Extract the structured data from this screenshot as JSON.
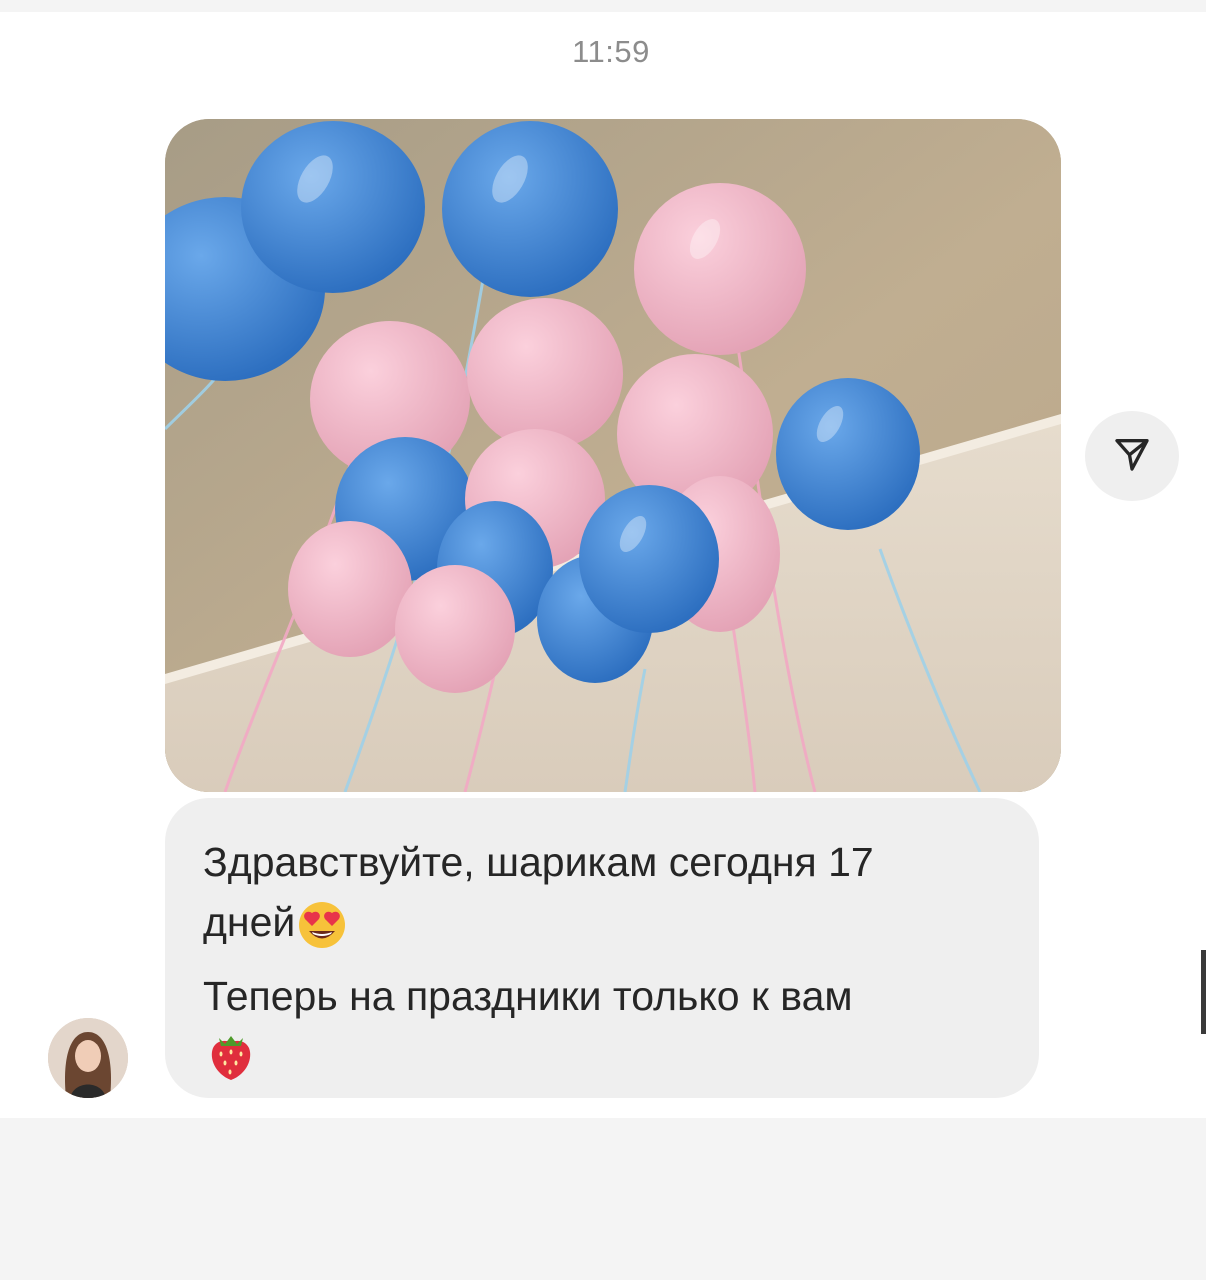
{
  "chat": {
    "timestamp": "11:59",
    "message": {
      "line1": "Здравствуйте, шарикам сегодня 17",
      "line2": "дней",
      "line3": "Теперь на праздники только к вам",
      "emoji_heart_eyes": "smiling-face-with-heart-eyes-icon",
      "emoji_strawberry": "strawberry-icon"
    },
    "photo": {
      "subject": "balloons-photo"
    },
    "share_icon": "paper-plane-icon"
  },
  "colors": {
    "bubble": "#efefef",
    "text": "#262626",
    "timestamp": "#8c8c8c",
    "balloon_blue": "#3f86d6",
    "balloon_pink": "#f0b5c6"
  }
}
